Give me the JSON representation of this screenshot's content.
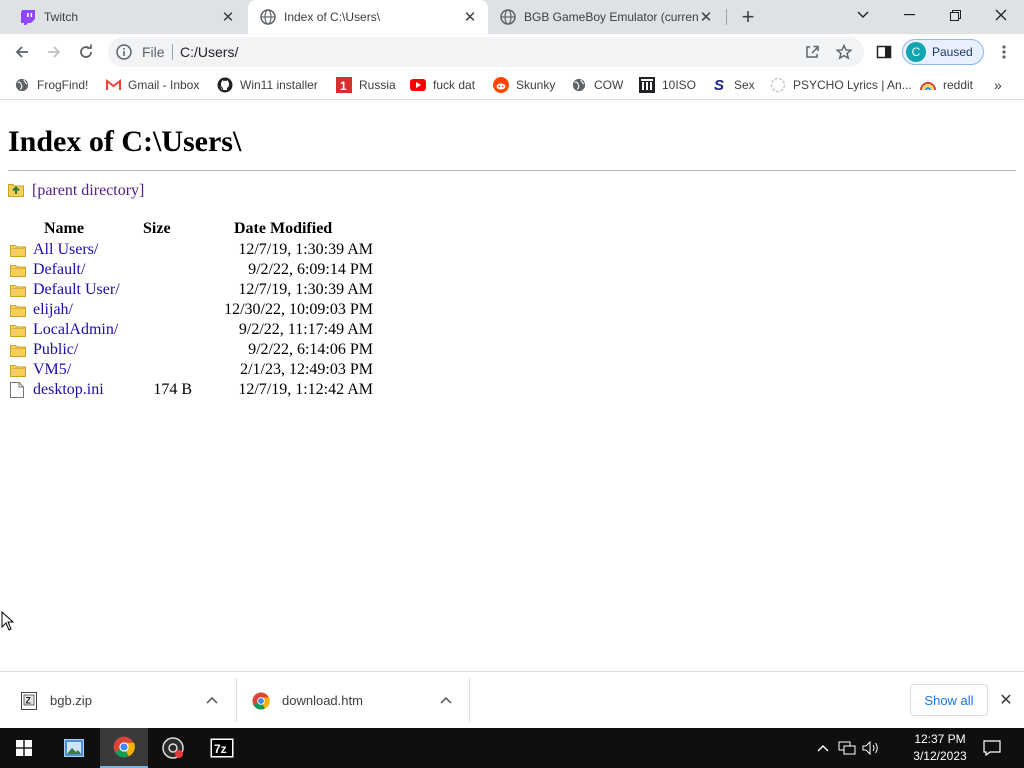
{
  "tabs": [
    {
      "title": "Twitch",
      "favicon": "twitch-icon",
      "active": false
    },
    {
      "title": "Index of C:\\Users\\",
      "favicon": "globe-icon",
      "active": true
    },
    {
      "title": "BGB GameBoy Emulator (current",
      "favicon": "globe-icon",
      "active": false
    }
  ],
  "omnibox": {
    "scheme_label": "File",
    "url": "C:/Users/"
  },
  "profile": {
    "initial": "C",
    "label": "Paused"
  },
  "bookmarks": [
    {
      "label": "FrogFind!",
      "icon": "globe-icon"
    },
    {
      "label": "Gmail - Inbox",
      "icon": "gmail-icon"
    },
    {
      "label": "Win11 installer",
      "icon": "github-icon"
    },
    {
      "label": "Russia",
      "icon": "russia-red-icon"
    },
    {
      "label": "fuck dat",
      "icon": "youtube-icon"
    },
    {
      "label": "Skunky",
      "icon": "reddit-icon"
    },
    {
      "label": "COW",
      "icon": "globe-icon"
    },
    {
      "label": "10ISO",
      "icon": "building-icon"
    },
    {
      "label": "Sex",
      "icon": "s-logo-icon"
    },
    {
      "label": "PSYCHO Lyrics | An...",
      "icon": "circle-icon"
    },
    {
      "label": "reddit",
      "icon": "rainbow-icon"
    }
  ],
  "page": {
    "heading": "Index of C:\\Users\\",
    "parent_label": "[parent directory]",
    "columns": {
      "name": "Name",
      "size": "Size",
      "date": "Date Modified"
    },
    "rows": [
      {
        "name": "All Users/",
        "size": "",
        "date": "12/7/19, 1:30:39 AM",
        "type": "folder"
      },
      {
        "name": "Default/",
        "size": "",
        "date": "9/2/22, 6:09:14 PM",
        "type": "folder"
      },
      {
        "name": "Default User/",
        "size": "",
        "date": "12/7/19, 1:30:39 AM",
        "type": "folder"
      },
      {
        "name": "elijah/",
        "size": "",
        "date": "12/30/22, 10:09:03 PM",
        "type": "folder"
      },
      {
        "name": "LocalAdmin/",
        "size": "",
        "date": "9/2/22, 11:17:49 AM",
        "type": "folder"
      },
      {
        "name": "Public/",
        "size": "",
        "date": "9/2/22, 6:14:06 PM",
        "type": "folder"
      },
      {
        "name": "VM5/",
        "size": "",
        "date": "2/1/23, 12:49:03 PM",
        "type": "folder"
      },
      {
        "name": "desktop.ini",
        "size": "174 B",
        "date": "12/7/19, 1:12:42 AM",
        "type": "file"
      }
    ]
  },
  "downloads": [
    {
      "name": "bgb.zip",
      "icon": "zip-file-icon"
    },
    {
      "name": "download.htm",
      "icon": "chrome-icon"
    }
  ],
  "shelf": {
    "show_all": "Show all"
  },
  "taskbar": {
    "apps": [
      "windows-start-icon",
      "photos-icon",
      "chrome-icon",
      "obs-icon",
      "7zip-icon"
    ],
    "time": "12:37 PM",
    "date": "3/12/2023"
  },
  "colors": {
    "link": "#1a0dab",
    "visited": "#551a8b",
    "accent": "#1a73e8",
    "taskbar": "#0f0f0f"
  }
}
